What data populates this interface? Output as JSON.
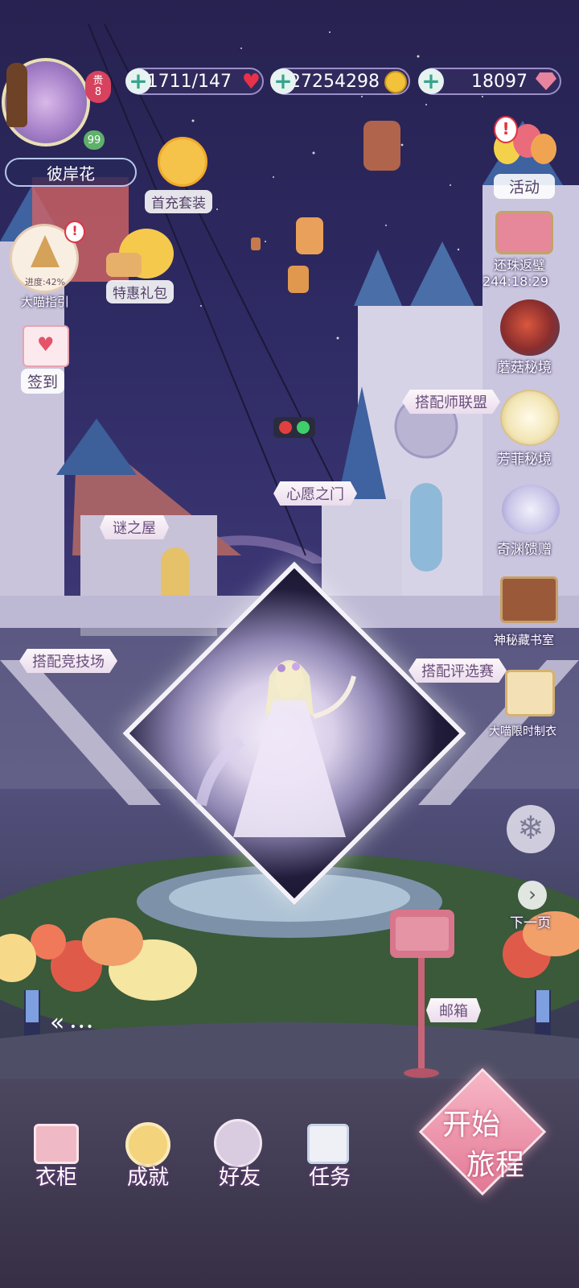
{
  "player": {
    "name": "彼岸花",
    "vip_level": "8",
    "vip_prefix": "贵",
    "level": "99"
  },
  "currencies": {
    "stamina": "51711/147",
    "gold": "27254298",
    "diamonds": "18097"
  },
  "left_menu": {
    "first_recharge": "首充套装",
    "guide_progress": "进度:42%",
    "guide_label": "大喵指引",
    "special_pack": "特惠礼包",
    "checkin": "签到"
  },
  "right_menu": {
    "activity": "活动",
    "return_pearl": "还珠返璧",
    "return_pearl_timer": "244:18:29",
    "mushroom": "蘑菇秘境",
    "fangfei": "芳菲秘境",
    "abyss": "奇渊馈赠",
    "library": "神秘藏书室",
    "tailor": "大喵限时制衣",
    "next_page": "下一页"
  },
  "signs": {
    "stylist_union": "搭配师联盟",
    "wish_gate": "心愿之门",
    "mystery_house": "谜之屋",
    "arena": "搭配竞技场",
    "selection": "搭配评选赛",
    "mailbox": "邮箱"
  },
  "start_button": {
    "line1": "开始",
    "line2": "旅程"
  },
  "bottom_nav": [
    {
      "label": "衣柜"
    },
    {
      "label": "成就"
    },
    {
      "label": "好友"
    },
    {
      "label": "任务"
    }
  ],
  "colors": {
    "sky": "#2e2a63",
    "pill_border": "#9b8fc8",
    "accent_pink": "#e88aa6",
    "sign_text": "#6a4e7b"
  }
}
